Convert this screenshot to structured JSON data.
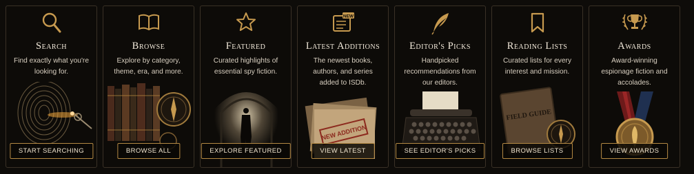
{
  "cards": [
    {
      "title": "Search",
      "description": "Find exactly what you're looking for.",
      "button": "START SEARCHING",
      "icon": "magnifier-icon",
      "art": "fingerprint-magnifier"
    },
    {
      "title": "Browse",
      "description": "Explore by category, theme, era, and more.",
      "button": "BROWSE ALL",
      "icon": "open-book-icon",
      "art": "bookshelf-compass"
    },
    {
      "title": "Featured",
      "description": "Curated highlights of essential spy fiction.",
      "button": "EXPLORE FEATURED",
      "icon": "star-icon",
      "art": "silhouette-tunnel"
    },
    {
      "title": "Latest Additions",
      "description": "The newest books, authors, and series added to ISDb.",
      "button": "VIEW LATEST",
      "icon": "new-document-icon",
      "icon_badge": "NEW",
      "art": "folders-stamp",
      "stamp_text": "NEW ADDITION"
    },
    {
      "title": "Editor's Picks",
      "description": "Handpicked recommendations from our editors.",
      "button": "SEE EDITOR'S PICKS",
      "icon": "quill-icon",
      "art": "typewriter"
    },
    {
      "title": "Reading Lists",
      "description": "Curated lists for every interest and mission.",
      "button": "BROWSE LISTS",
      "icon": "bookmark-icon",
      "art": "field-guide-compass",
      "notebook_text": "FIELD GUIDE"
    },
    {
      "title": "Awards",
      "description": "Award-winning espionage fiction and accolades.",
      "button": "VIEW AWARDS",
      "icon": "trophy-laurel-icon",
      "art": "medal"
    }
  ],
  "colors": {
    "accent": "#c79a4f",
    "card_bg": "#0d0b08",
    "border": "#3a3126",
    "title": "#f3eadb",
    "text": "#d8cfc0"
  }
}
